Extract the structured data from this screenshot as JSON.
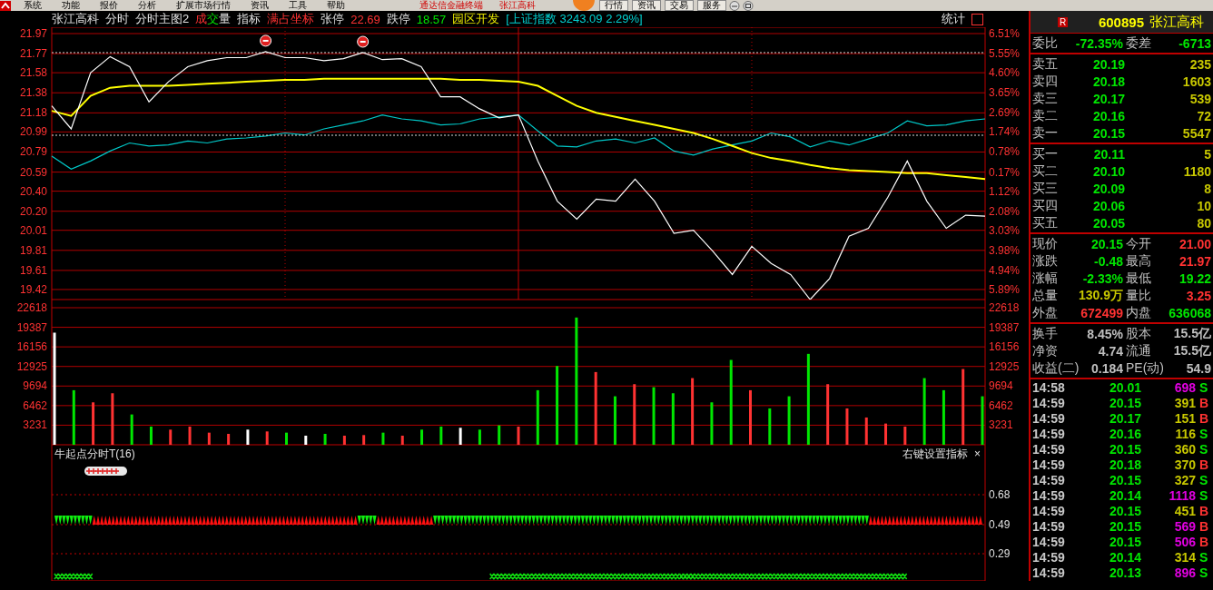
{
  "menu_bar": {
    "items": [
      "系统",
      "功能",
      "报价",
      "分析",
      "扩展市场行情",
      "资讯",
      "工具",
      "帮助"
    ],
    "app_title": "通达信金融终端",
    "stock_title": "张江高科",
    "buttons": [
      "行情",
      "资讯",
      "交易",
      "服务"
    ]
  },
  "chart_header": {
    "items": [
      {
        "text": "张江高科",
        "kind": "plain"
      },
      {
        "text": "分时",
        "kind": "plain"
      },
      {
        "text": "分时主图2",
        "kind": "plain"
      },
      {
        "text": "成交量",
        "kind": "tricolor"
      },
      {
        "text": "指标",
        "kind": "plain"
      },
      {
        "text": "满占坐标",
        "kind": "red"
      },
      {
        "text": "张停",
        "kind": "plain"
      },
      {
        "text": "22.69",
        "kind": "red"
      },
      {
        "text": "跌停",
        "kind": "plain"
      },
      {
        "text": "18.57",
        "kind": "green"
      },
      {
        "text": "园区开发",
        "kind": "yellow"
      },
      {
        "text": "[上证指数 3243.09 2.29%]",
        "kind": "cyan"
      }
    ],
    "stats_button": "统计"
  },
  "price_chart": {
    "chart_data": {
      "type": "line",
      "grid": true,
      "ylim": [
        19.32,
        21.97
      ],
      "yticks": [
        21.97,
        21.77,
        21.58,
        21.38,
        21.18,
        20.99,
        20.79,
        20.59,
        {
          "value": 20.4,
          "label": "20.40"
        },
        {
          "value": 20.2,
          "label": "20.20"
        },
        20.01,
        19.81,
        19.61,
        19.42
      ],
      "series": [
        {
          "color": "#ffffff",
          "values": [
            21.25,
            21.02,
            21.58,
            21.74,
            21.64,
            21.29,
            21.49,
            21.64,
            21.7,
            21.73,
            21.73,
            21.79,
            21.73,
            21.73,
            21.7,
            21.72,
            21.78,
            21.71,
            21.72,
            21.64,
            21.34,
            21.34,
            21.22,
            21.13,
            21.16,
            20.7,
            20.3,
            20.12,
            20.32,
            20.3,
            20.52,
            20.3,
            19.98,
            20.01,
            19.8,
            19.57,
            19.85,
            19.68,
            19.57,
            19.32,
            19.53,
            19.95,
            20.03,
            20.34,
            20.7,
            20.3,
            20.03,
            20.16,
            20.15
          ]
        },
        {
          "color": "#ffff00",
          "values": [
            21.2,
            21.15,
            21.35,
            21.43,
            21.45,
            21.45,
            21.45,
            21.46,
            21.47,
            21.48,
            21.49,
            21.5,
            21.51,
            21.51,
            21.52,
            21.52,
            21.52,
            21.52,
            21.52,
            21.52,
            21.52,
            21.51,
            21.51,
            21.5,
            21.49,
            21.45,
            21.35,
            21.25,
            21.18,
            21.14,
            21.1,
            21.06,
            21.02,
            20.98,
            20.92,
            20.85,
            20.78,
            20.73,
            20.7,
            20.66,
            20.63,
            20.61,
            20.6,
            20.59,
            20.58,
            20.58,
            20.56,
            20.54,
            20.52
          ]
        },
        {
          "color": "#00c8c8",
          "values": [
            20.75,
            20.62,
            20.7,
            20.8,
            20.88,
            20.85,
            20.86,
            20.9,
            20.88,
            20.92,
            20.93,
            20.95,
            20.98,
            20.96,
            21.02,
            21.06,
            21.1,
            21.16,
            21.12,
            21.1,
            21.06,
            21.07,
            21.12,
            21.14,
            21.16,
            21.0,
            20.85,
            20.84,
            20.9,
            20.92,
            20.88,
            20.93,
            20.8,
            20.76,
            20.82,
            20.86,
            20.9,
            20.98,
            20.94,
            20.84,
            20.9,
            20.86,
            20.92,
            20.98,
            21.1,
            21.05,
            21.06,
            21.1,
            21.12
          ]
        }
      ]
    },
    "markers": [
      {
        "kind": "high"
      },
      {
        "kind": "high"
      }
    ],
    "right_axis_labels": [
      "6.51%",
      "5.55%",
      "4.60%",
      "3.65%",
      "2.69%",
      "1.74%",
      "0.78%",
      "0.17%",
      "1.12%",
      "2.08%",
      "3.03%",
      "3.98%",
      "4.94%",
      "5.89%"
    ]
  },
  "volume_chart": {
    "chart_data": {
      "type": "bar",
      "grid": true,
      "ylim": [
        0,
        22618
      ],
      "yticks": [
        22618,
        19387,
        16156,
        12925,
        9694,
        6462,
        3231
      ],
      "series": [
        {
          "values": [
            18500,
            9000,
            7000,
            8500,
            5000,
            3000,
            2500,
            3000,
            2000,
            1800,
            2500,
            2200,
            2000,
            1500,
            1800,
            1500,
            1600,
            2000,
            1500,
            2500,
            3000,
            2800,
            2500,
            3200,
            3000,
            9000,
            13000,
            21000,
            12000,
            8000,
            10000,
            9500,
            8500,
            11000,
            7000,
            14000,
            9000,
            6000,
            8000,
            15000,
            10000,
            6000,
            4500,
            3500,
            3000,
            11000,
            9000,
            12500,
            8000
          ]
        }
      ]
    },
    "right_axis_labels": [
      "22618",
      "19387",
      "16156",
      "12925",
      "9694",
      "6462",
      "3231"
    ]
  },
  "indicator": {
    "title": "牛起点分时T(16)",
    "settings_hint": "右键设置指标",
    "close": "×",
    "axis_labels": [
      "0.68",
      "0.49",
      "0.29"
    ],
    "rising": [
      false,
      false,
      true,
      true,
      true,
      true,
      true,
      true,
      true,
      true,
      true,
      true,
      true,
      true,
      true,
      true,
      false,
      true,
      true,
      true,
      false,
      false,
      false,
      false,
      false,
      false,
      false,
      false,
      false,
      false,
      false,
      false,
      false,
      false,
      false,
      false,
      false,
      false,
      false,
      false,
      false,
      false,
      false,
      true,
      true,
      true,
      true,
      true,
      true
    ],
    "crosses": [
      true,
      true,
      false,
      false,
      false,
      false,
      false,
      false,
      false,
      false,
      false,
      false,
      false,
      false,
      false,
      false,
      false,
      false,
      false,
      false,
      false,
      false,
      false,
      true,
      true,
      true,
      true,
      true,
      true,
      true,
      true,
      true,
      true,
      true,
      true,
      true,
      true,
      true,
      true,
      true,
      true,
      true,
      true,
      true,
      true,
      false,
      false,
      false,
      false
    ]
  },
  "quote_panel": {
    "badge": "R",
    "code": "600895",
    "name": "张江高科",
    "ratio_row": [
      {
        "label": "委比",
        "value": "-72.35%",
        "color": "#00e600"
      },
      {
        "label": "委差",
        "value": "-6713",
        "color": "#00e600"
      }
    ],
    "asks": [
      {
        "label": "卖五",
        "price": "20.19",
        "volume": "235"
      },
      {
        "label": "卖四",
        "price": "20.18",
        "volume": "1603"
      },
      {
        "label": "卖三",
        "price": "20.17",
        "volume": "539"
      },
      {
        "label": "卖二",
        "price": "20.16",
        "volume": "72"
      },
      {
        "label": "卖一",
        "price": "20.15",
        "volume": "5547"
      }
    ],
    "bids": [
      {
        "label": "买一",
        "price": "20.11",
        "volume": "5"
      },
      {
        "label": "买二",
        "price": "20.10",
        "volume": "1180"
      },
      {
        "label": "买三",
        "price": "20.09",
        "volume": "8"
      },
      {
        "label": "买四",
        "price": "20.06",
        "volume": "10"
      },
      {
        "label": "买五",
        "price": "20.05",
        "volume": "80"
      }
    ],
    "quote_rows": [
      [
        {
          "label": "现价",
          "value": "20.15",
          "color": "#00e600"
        },
        {
          "label": "今开",
          "value": "21.00",
          "color": "#ff3232"
        }
      ],
      [
        {
          "label": "涨跌",
          "value": "-0.48",
          "color": "#00e600"
        },
        {
          "label": "最高",
          "value": "21.97",
          "color": "#ff3232"
        }
      ],
      [
        {
          "label": "涨幅",
          "value": "-2.33%",
          "color": "#00e600"
        },
        {
          "label": "最低",
          "value": "19.22",
          "color": "#00e600"
        }
      ],
      [
        {
          "label": "总量",
          "value": "130.9万",
          "color": "#c8c800"
        },
        {
          "label": "量比",
          "value": "3.25",
          "color": "#ff3232"
        }
      ],
      [
        {
          "label": "外盘",
          "value": "672499",
          "color": "#ff3232"
        },
        {
          "label": "内盘",
          "value": "636068",
          "color": "#00e600"
        }
      ]
    ],
    "fundamental_rows": [
      [
        {
          "label": "换手",
          "value": "8.45%",
          "color": "#c0c0c0"
        },
        {
          "label": "股本",
          "value": "15.5亿",
          "color": "#c0c0c0"
        }
      ],
      [
        {
          "label": "净资",
          "value": "4.74",
          "color": "#c0c0c0"
        },
        {
          "label": "流通",
          "value": "15.5亿",
          "color": "#c0c0c0"
        }
      ],
      [
        {
          "label": "收益(二)",
          "value": "0.184",
          "color": "#c0c0c0"
        },
        {
          "label": "PE(动)",
          "value": "54.9",
          "color": "#c0c0c0"
        }
      ]
    ],
    "trades": [
      {
        "time": "14:58",
        "price": "20.01",
        "volume": "698",
        "color": "#e000e0",
        "side": "S",
        "kind": "sell"
      },
      {
        "time": "14:59",
        "price": "20.15",
        "volume": "391",
        "color": "#c8c800",
        "side": "B",
        "kind": "buy"
      },
      {
        "time": "14:59",
        "price": "20.17",
        "volume": "151",
        "color": "#c8c800",
        "side": "B",
        "kind": "buy"
      },
      {
        "time": "14:59",
        "price": "20.16",
        "volume": "116",
        "color": "#c8c800",
        "side": "S",
        "kind": "sell"
      },
      {
        "time": "14:59",
        "price": "20.15",
        "volume": "360",
        "color": "#c8c800",
        "side": "S",
        "kind": "sell"
      },
      {
        "time": "14:59",
        "price": "20.18",
        "volume": "370",
        "color": "#c8c800",
        "side": "B",
        "kind": "buy"
      },
      {
        "time": "14:59",
        "price": "20.15",
        "volume": "327",
        "color": "#c8c800",
        "side": "S",
        "kind": "sell"
      },
      {
        "time": "14:59",
        "price": "20.14",
        "volume": "1118",
        "color": "#e000e0",
        "side": "S",
        "kind": "sell"
      },
      {
        "time": "14:59",
        "price": "20.15",
        "volume": "451",
        "color": "#c8c800",
        "side": "B",
        "kind": "buy"
      },
      {
        "time": "14:59",
        "price": "20.15",
        "volume": "569",
        "color": "#e000e0",
        "side": "B",
        "kind": "buy"
      },
      {
        "time": "14:59",
        "price": "20.15",
        "volume": "506",
        "color": "#e000e0",
        "side": "B",
        "kind": "buy"
      },
      {
        "time": "14:59",
        "price": "20.14",
        "volume": "314",
        "color": "#c8c800",
        "side": "S",
        "kind": "sell"
      },
      {
        "time": "14:59",
        "price": "20.13",
        "volume": "896",
        "color": "#e000e0",
        "side": "S",
        "kind": "sell"
      }
    ]
  }
}
